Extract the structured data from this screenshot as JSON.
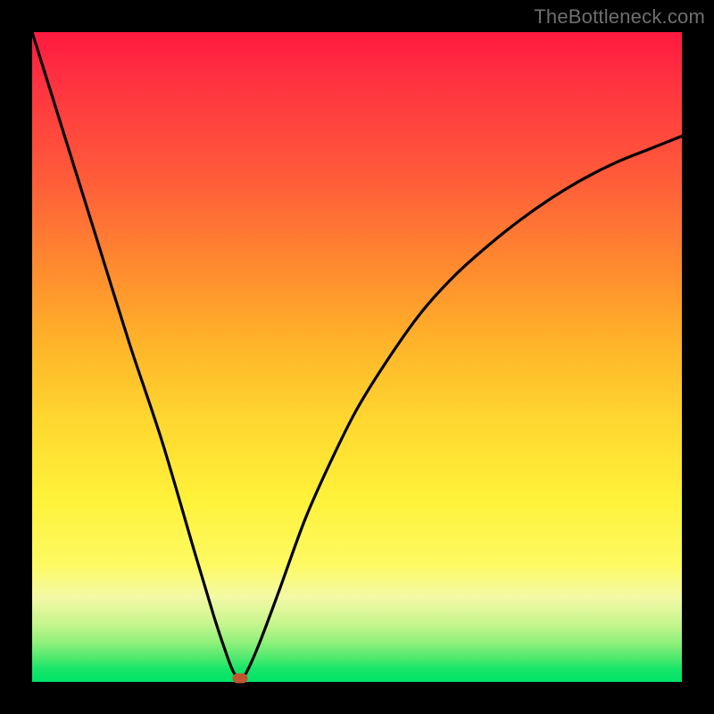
{
  "watermark": "TheBottleneck.com",
  "colors": {
    "marker": "#c1552f",
    "curve_stroke": "#000000"
  },
  "chart_data": {
    "type": "line",
    "title": "",
    "xlabel": "",
    "ylabel": "",
    "xlim": [
      0,
      100
    ],
    "ylim": [
      0,
      100
    ],
    "grid": false,
    "series": [
      {
        "name": "bottleneck-curve",
        "x": [
          0,
          5,
          10,
          15,
          20,
          25,
          28,
          30,
          31,
          32,
          33,
          35,
          38,
          42,
          46,
          50,
          55,
          60,
          65,
          70,
          75,
          80,
          85,
          90,
          95,
          100
        ],
        "values": [
          100,
          84,
          68,
          52,
          37,
          20,
          10,
          4,
          1.5,
          0.5,
          1.5,
          6,
          14,
          25,
          34,
          42,
          50,
          57,
          62.5,
          67,
          71,
          74.5,
          77.5,
          80,
          82,
          84
        ]
      }
    ],
    "annotations": [
      {
        "name": "optimal-point",
        "x": 32,
        "y": 0.5
      }
    ]
  }
}
